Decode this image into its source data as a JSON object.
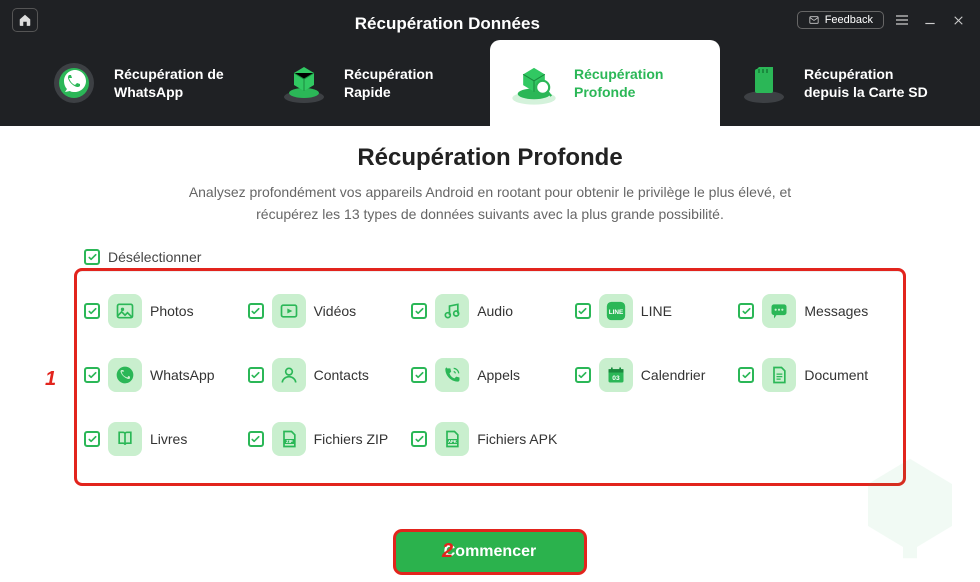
{
  "header": {
    "title": "Récupération Données",
    "feedback": "Feedback"
  },
  "tabs": [
    {
      "line1": "Récupération de",
      "line2": "WhatsApp"
    },
    {
      "line1": "Récupération",
      "line2": "Rapide"
    },
    {
      "line1": "Récupération",
      "line2": "Profonde"
    },
    {
      "line1": "Récupération",
      "line2": "depuis la Carte SD"
    }
  ],
  "page": {
    "title": "Récupération Profonde",
    "desc1": "Analysez profondément vos appareils Android en rootant pour obtenir le privilège le plus élevé, et",
    "desc2": "récupérez les 13 types de données suivants avec la plus grande possibilité."
  },
  "deselect_label": "Désélectionner",
  "items": [
    {
      "label": "Photos"
    },
    {
      "label": "Vidéos"
    },
    {
      "label": "Audio"
    },
    {
      "label": "LINE"
    },
    {
      "label": "Messages"
    },
    {
      "label": "WhatsApp"
    },
    {
      "label": "Contacts"
    },
    {
      "label": "Appels"
    },
    {
      "label": "Calendrier"
    },
    {
      "label": "Document"
    },
    {
      "label": "Livres"
    },
    {
      "label": "Fichiers ZIP"
    },
    {
      "label": "Fichiers APK"
    }
  ],
  "start_label": "Commencer",
  "annotations": {
    "one": "1",
    "two": "2"
  }
}
